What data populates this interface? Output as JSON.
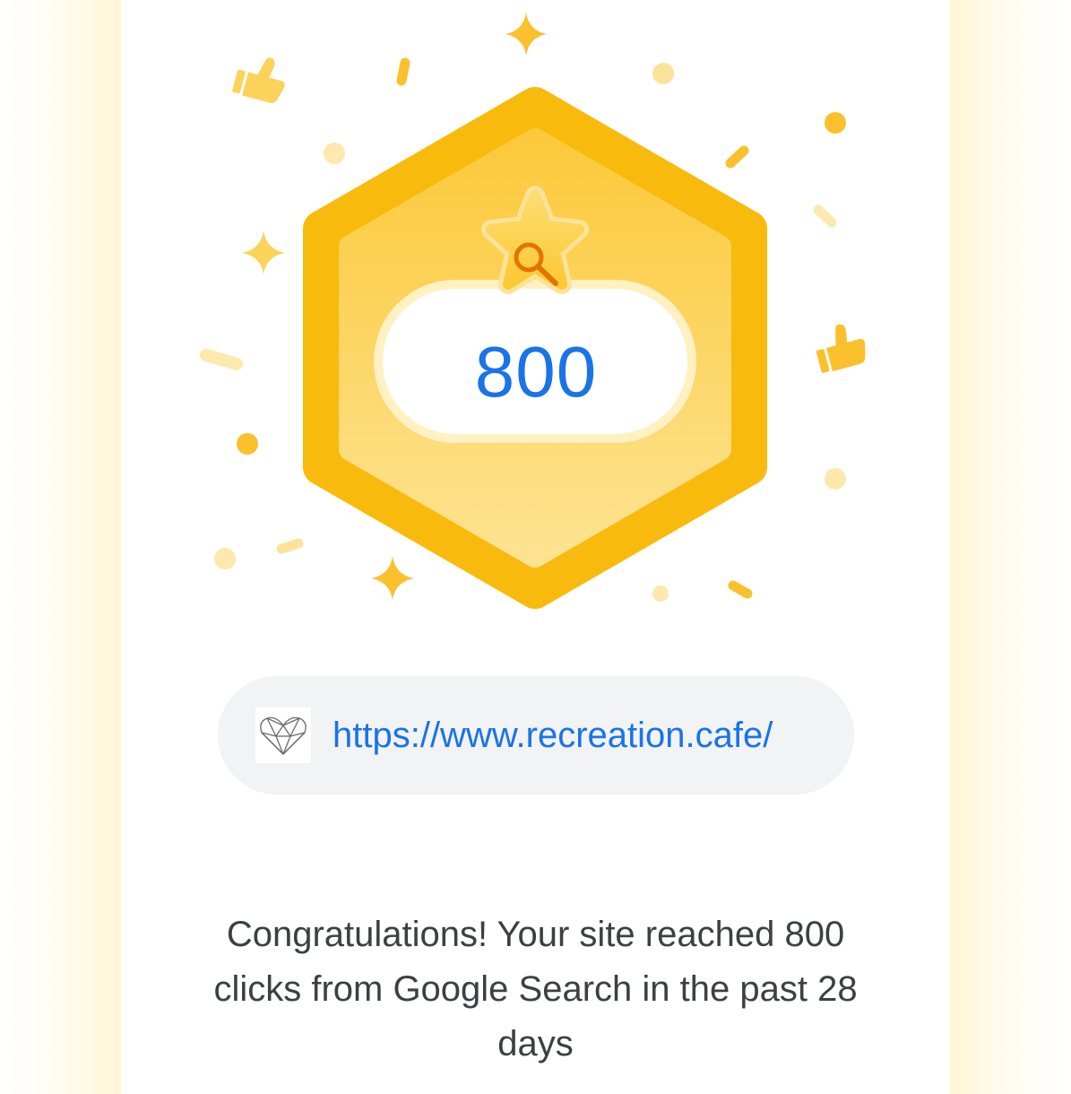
{
  "badge": {
    "value": "800",
    "icon": "search-star-icon",
    "colors": {
      "outer": "#f8bb0d",
      "inner": "#fdd14a",
      "confetti": "#fbc02d",
      "value_text": "#1a73e8",
      "search_icon": "#e37400"
    }
  },
  "site": {
    "url": "https://www.recreation.cafe/",
    "favicon": "geometric-heart-icon",
    "chip_background": "#f1f3f4"
  },
  "message": {
    "text": "Congratulations! Your site reached 800 clicks from Google Search in the past 28 days"
  }
}
